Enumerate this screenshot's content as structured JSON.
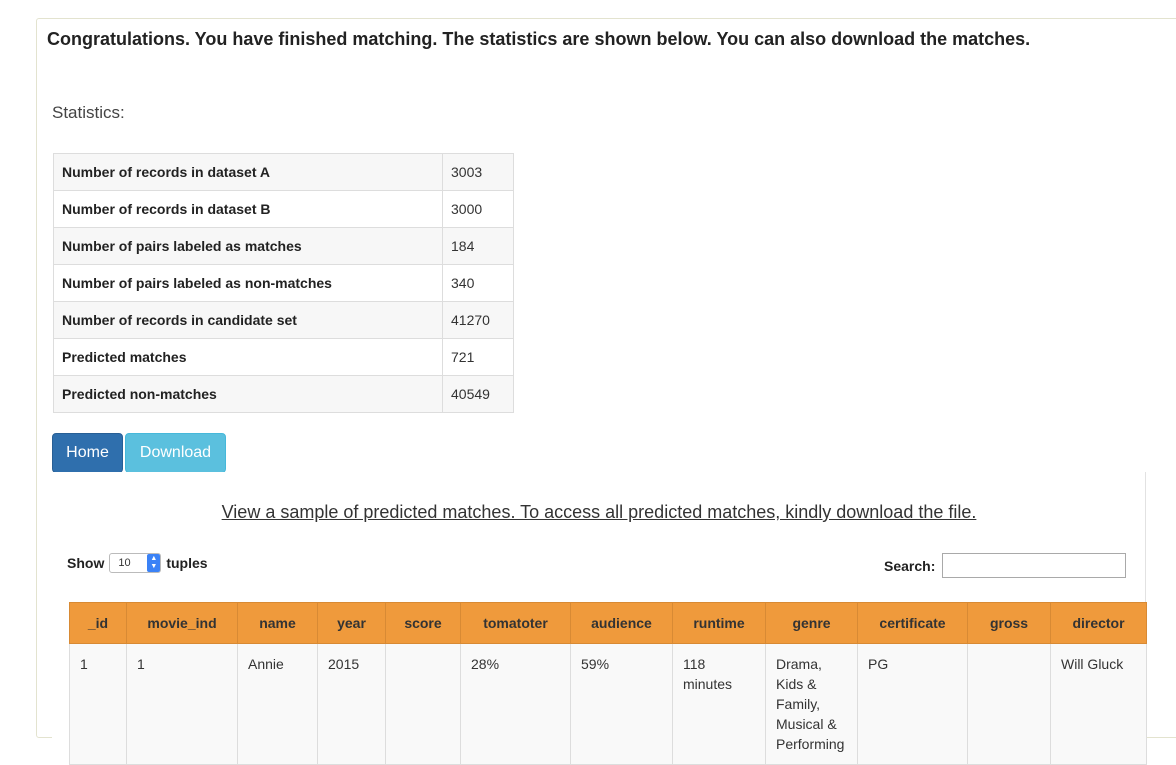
{
  "headline": "Congratulations. You have finished matching. The statistics are shown below. You can also download the matches.",
  "statistics_label": "Statistics:",
  "stats": [
    {
      "label": "Number of records in dataset A",
      "value": "3003"
    },
    {
      "label": "Number of records in dataset B",
      "value": "3000"
    },
    {
      "label": "Number of pairs labeled as matches",
      "value": "184"
    },
    {
      "label": "Number of pairs labeled as non-matches",
      "value": "340"
    },
    {
      "label": "Number of records in candidate set",
      "value": "41270"
    },
    {
      "label": "Predicted matches",
      "value": "721"
    },
    {
      "label": "Predicted non-matches",
      "value": "40549"
    }
  ],
  "buttons": {
    "home": "Home",
    "download": "Download"
  },
  "sample_link": "View a sample of predicted matches. To access all predicted matches, kindly download the file.",
  "table_controls": {
    "show_label": "Show",
    "page_size": "10",
    "tuples_label": "tuples",
    "search_label": "Search:",
    "search_value": ""
  },
  "columns": [
    "_id",
    "movie_ind",
    "name",
    "year",
    "score",
    "tomatoter",
    "audience",
    "runtime",
    "genre",
    "certificate",
    "gross",
    "director"
  ],
  "rows": [
    [
      "1",
      "1",
      "Annie",
      "2015",
      "",
      "28%",
      "59%",
      "118 minutes",
      "Drama, Kids & Family, Musical & Performing",
      "PG",
      "",
      "Will Gluck"
    ]
  ],
  "colors": {
    "header_bg": "#ef9a3c",
    "home_btn": "#2f6fad",
    "download_btn": "#5bc0de"
  }
}
